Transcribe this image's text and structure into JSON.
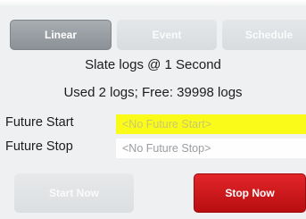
{
  "mode_tabs": [
    {
      "label": "Linear",
      "state": "selected"
    },
    {
      "label": "Event",
      "state": "unselected"
    },
    {
      "label": "Schedule",
      "state": "unselected"
    }
  ],
  "status": {
    "rate_text": "Slate logs @  1 Second",
    "usage_text": "Used 2 logs; Free: 39998 logs"
  },
  "future_start": {
    "label": "Future Start",
    "value": "<No Future Start>"
  },
  "future_stop": {
    "label": "Future Stop",
    "value": "<No Future Stop>"
  },
  "actions": {
    "start_label": "Start Now",
    "stop_label": "Stop Now"
  },
  "colors": {
    "selected_tab": "#8b9196",
    "start_field_highlight": "#fbfb1a",
    "stop_button": "#c91417"
  }
}
